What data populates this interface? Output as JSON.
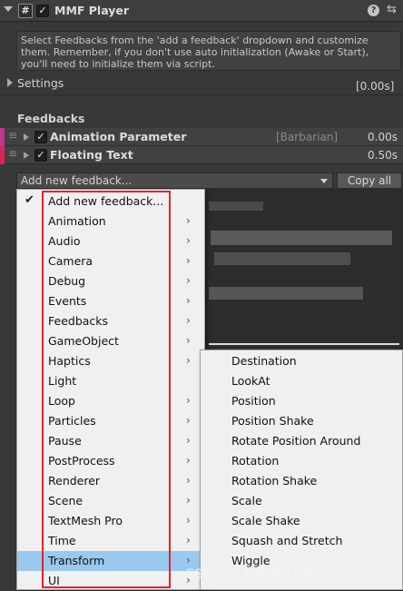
{
  "header": {
    "title": "MMF Player",
    "enabled": true,
    "help_glyph": "?",
    "settings_glyph": "⇆",
    "hash_glyph": "#"
  },
  "helpbox": {
    "text": "Select Feedbacks from the 'add a feedback' dropdown and customize them. Remember, if you don't use auto initialization (Awake or Start), you'll need to initialize them via script."
  },
  "settings": {
    "label": "Settings",
    "time": "[0.00s]"
  },
  "feedbacks": {
    "title": "Feedbacks",
    "items": [
      {
        "name": "Animation Parameter",
        "extra": "[Barbarian]",
        "time": "0.00s",
        "color": "#c4338f"
      },
      {
        "name": "Floating Text",
        "extra": "",
        "time": "0.50s",
        "color": "#d8245b"
      }
    ]
  },
  "add_feedback": {
    "label": "Add new feedback...",
    "copy_all": "Copy all"
  },
  "menu": {
    "selected": "Add new feedback...",
    "items": [
      {
        "label": "Add new feedback...",
        "checked": true,
        "submenu": false
      },
      {
        "label": "Animation",
        "submenu": true
      },
      {
        "label": "Audio",
        "submenu": true
      },
      {
        "label": "Camera",
        "submenu": true
      },
      {
        "label": "Debug",
        "submenu": true
      },
      {
        "label": "Events",
        "submenu": true
      },
      {
        "label": "Feedbacks",
        "submenu": true
      },
      {
        "label": "GameObject",
        "submenu": true
      },
      {
        "label": "Haptics",
        "submenu": true
      },
      {
        "label": "Light",
        "submenu": false
      },
      {
        "label": "Loop",
        "submenu": true
      },
      {
        "label": "Particles",
        "submenu": true
      },
      {
        "label": "Pause",
        "submenu": true
      },
      {
        "label": "PostProcess",
        "submenu": true
      },
      {
        "label": "Renderer",
        "submenu": true
      },
      {
        "label": "Scene",
        "submenu": true
      },
      {
        "label": "TextMesh Pro",
        "submenu": true
      },
      {
        "label": "Time",
        "submenu": true
      },
      {
        "label": "Transform",
        "submenu": true,
        "highlighted": true
      },
      {
        "label": "UI",
        "submenu": true
      }
    ]
  },
  "submenu": {
    "parent": "Transform",
    "items": [
      "Destination",
      "LookAt",
      "Position",
      "Position Shake",
      "Rotate Position Around",
      "Rotation",
      "Rotation Shake",
      "Scale",
      "Scale Shake",
      "Squash and Stretch",
      "Wiggle"
    ]
  },
  "watermark": "CSDN @呆呆敲代码的小Y",
  "colors": {
    "highlight": "#99c9ef",
    "outline": "#e0242b",
    "menu_bg": "#f0f0f0",
    "panel_bg": "#383838"
  }
}
